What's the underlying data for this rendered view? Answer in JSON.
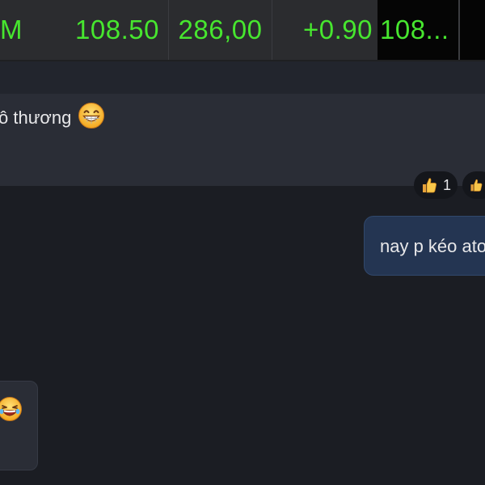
{
  "stock_strip": {
    "cells": [
      "M",
      "108.50",
      "286,00",
      "+0.90",
      "108..."
    ],
    "text_color": "#47e62f"
  },
  "messages": {
    "incoming_1": {
      "text": "ô thương",
      "emoji": "grinning-face-emoji"
    },
    "reactions": [
      {
        "icon": "thumbs-up-icon",
        "count": "1"
      },
      {
        "icon": "thumbs-up-icon",
        "count": ""
      }
    ],
    "outgoing_1": {
      "text": "nay p kéo ato"
    },
    "incoming_2": {
      "emoji": "laughing-crying-face-emoji"
    }
  },
  "colors": {
    "background": "#1b1d23",
    "incoming_bubble": "#2a2d36",
    "outgoing_bubble": "#243552",
    "price_green": "#47e62f"
  }
}
